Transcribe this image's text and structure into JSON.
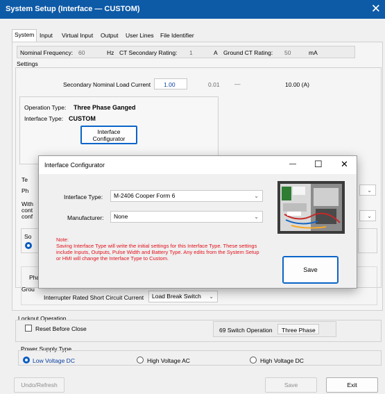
{
  "window": {
    "title": "System Setup (Interface — CUSTOM)",
    "close_glyph": "✕"
  },
  "tabs": [
    "System",
    "Input",
    "Virtual Input",
    "Output",
    "User Lines",
    "File Identifier"
  ],
  "ratings": {
    "nominal_freq_label": "Nominal Frequency:",
    "nominal_freq_value": "60",
    "nominal_freq_unit": "Hz",
    "ct_sec_label": "CT Secondary Rating:",
    "ct_sec_value": "1",
    "ct_sec_unit": "A",
    "ground_ct_label": "Ground CT Rating:",
    "ground_ct_value": "50",
    "ground_ct_unit": "mA"
  },
  "settings": {
    "group_label": "Settings",
    "sec_load_label": "Secondary Nominal Load Current",
    "sec_load_value": "1.00",
    "sec_load_min": "0.01",
    "sec_load_dash": "—",
    "sec_load_max": "10.00 (A)",
    "op_type_label": "Operation Type:",
    "op_type_value": "Three Phase Ganged",
    "iface_type_label": "Interface Type:",
    "iface_type_value": "CUSTOM",
    "iface_cfg_btn_line1": "Interface",
    "iface_cfg_btn_line2": "Configurator",
    "partial_te": "Te",
    "partial_ph": "Ph",
    "partial_with": "With",
    "partial_cont": "cont",
    "partial_conf": "conf",
    "partial_so": "So",
    "partial_pha": "Pha",
    "partial_grou": "Grou",
    "interrupter_label": "Interrupter Rated Short Circuit Current",
    "interrupter_value": "Load Break Switch"
  },
  "lockout": {
    "group_label": "Lockout Operation",
    "reset_label": "Reset Before Close",
    "switch69_label": "69 Switch Operation",
    "switch69_value": "Three Phase"
  },
  "power_supply": {
    "group_label": "Power Supply Type",
    "options": [
      "Low Voltage DC",
      "High Voltage AC",
      "High Voltage DC"
    ]
  },
  "footer": {
    "undo_label": "Undo/Refresh",
    "save_label": "Save",
    "exit_label": "Exit"
  },
  "dialog": {
    "title": "Interface Configurator",
    "minimize_glyph": "—",
    "maximize_glyph": "☐",
    "close_glyph": "✕",
    "iface_type_label": "Interface Type:",
    "iface_type_value": "M-2406 Cooper Form 6",
    "manufacturer_label": "Manufacturer:",
    "manufacturer_value": "None",
    "note_title": "Note:",
    "note_body": "Saving Interface Type will write the initial settings for this Interface Type. These settings include Inputs, Outputs, Pulse Width and Battery Type. Any edits from the System Setup or HMI will change the Interface Type to Custom.",
    "save_label": "Save"
  },
  "colors": {
    "titlebar": "#0d5aa7",
    "note": "#e0101a",
    "accent": "#0a5cc2"
  }
}
